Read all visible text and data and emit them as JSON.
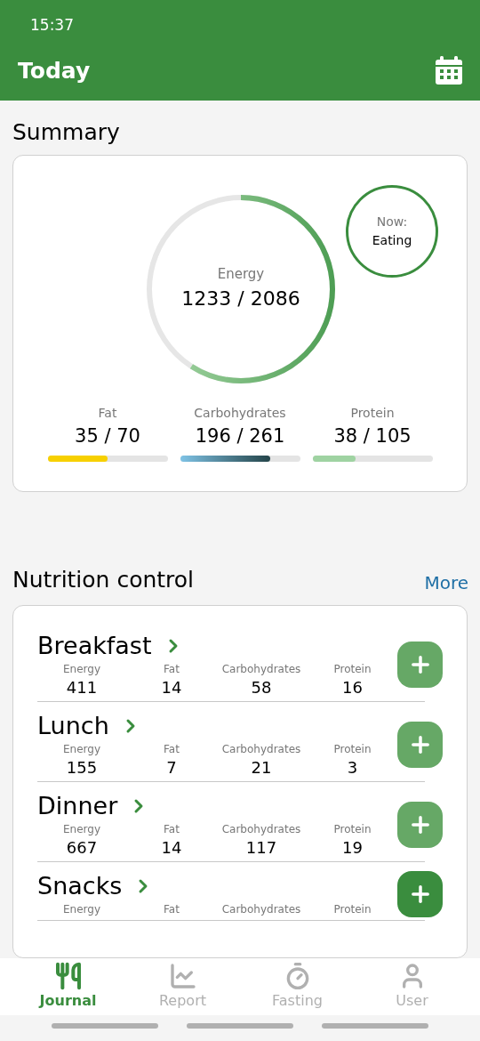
{
  "status_bar": {
    "time": "15:37"
  },
  "header": {
    "title": "Today"
  },
  "summary": {
    "title": "Summary",
    "energy": {
      "label": "Energy",
      "value": "1233 / 2086",
      "level": 0.59
    },
    "now": {
      "label": "Now:",
      "value": "Eating"
    },
    "macros": [
      {
        "label": "Fat",
        "value": "35 / 70",
        "level": 0.5,
        "kind": "fat"
      },
      {
        "label": "Carbohydrates",
        "value": "196 / 261",
        "level": 0.75,
        "kind": "carbs"
      },
      {
        "label": "Protein",
        "value": "38 / 105",
        "level": 0.36,
        "kind": "protein"
      }
    ]
  },
  "nutrition": {
    "title": "Nutrition control",
    "more": "More",
    "meals": [
      {
        "name": "Breakfast",
        "pressed": false,
        "stats": [
          {
            "label": "Energy",
            "value": "411"
          },
          {
            "label": "Fat",
            "value": "14"
          },
          {
            "label": "Carbohydrates",
            "value": "58"
          },
          {
            "label": "Protein",
            "value": "16"
          }
        ]
      },
      {
        "name": "Lunch",
        "pressed": false,
        "stats": [
          {
            "label": "Energy",
            "value": "155"
          },
          {
            "label": "Fat",
            "value": "7"
          },
          {
            "label": "Carbohydrates",
            "value": "21"
          },
          {
            "label": "Protein",
            "value": "3"
          }
        ]
      },
      {
        "name": "Dinner",
        "pressed": false,
        "stats": [
          {
            "label": "Energy",
            "value": "667"
          },
          {
            "label": "Fat",
            "value": "14"
          },
          {
            "label": "Carbohydrates",
            "value": "117"
          },
          {
            "label": "Protein",
            "value": "19"
          }
        ]
      },
      {
        "name": "Snacks",
        "pressed": true,
        "stats": [
          {
            "label": "Energy"
          },
          {
            "label": "Fat"
          },
          {
            "label": "Carbohydrates"
          },
          {
            "label": "Protein"
          }
        ]
      }
    ]
  },
  "tabs": [
    {
      "label": "Journal",
      "kind": "journal",
      "selected": true
    },
    {
      "label": "Report",
      "kind": "report",
      "selected": false
    },
    {
      "label": "Fasting",
      "kind": "fasting",
      "selected": false
    },
    {
      "label": "User",
      "kind": "user",
      "selected": false
    }
  ]
}
